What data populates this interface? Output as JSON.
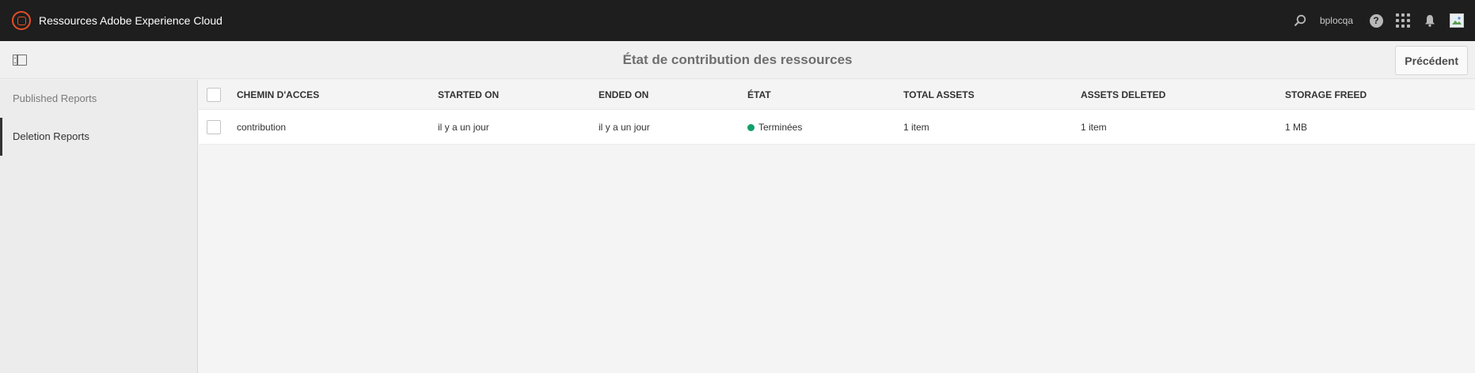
{
  "shell": {
    "title": "Ressources Adobe Experience Cloud",
    "user": "bplocqa",
    "help_glyph": "?",
    "icons": [
      "search-icon",
      "help-icon",
      "apps-icon",
      "bell-icon",
      "avatar-image"
    ]
  },
  "actionbar": {
    "title": "État de contribution des ressources",
    "back_label": "Précédent"
  },
  "rail": {
    "items": [
      {
        "label": "Published Reports",
        "active": false
      },
      {
        "label": "Deletion Reports",
        "active": true
      }
    ]
  },
  "table": {
    "headers": [
      "CHEMIN D'ACCES",
      "STARTED ON",
      "ENDED ON",
      "ÉTAT",
      "TOTAL ASSETS",
      "ASSETS DELETED",
      "STORAGE FREED"
    ],
    "rows": [
      {
        "path": "contribution",
        "started": "il y a un jour",
        "ended": "il y a un jour",
        "status": "Terminées",
        "status_color": "#12a06a",
        "total_assets": "1 item",
        "assets_deleted": "1 item",
        "storage_freed": "1 MB"
      }
    ]
  },
  "colors": {
    "shell_bg": "#1e1e1e",
    "logo_accent": "#e34f26",
    "status_done": "#12a06a"
  }
}
